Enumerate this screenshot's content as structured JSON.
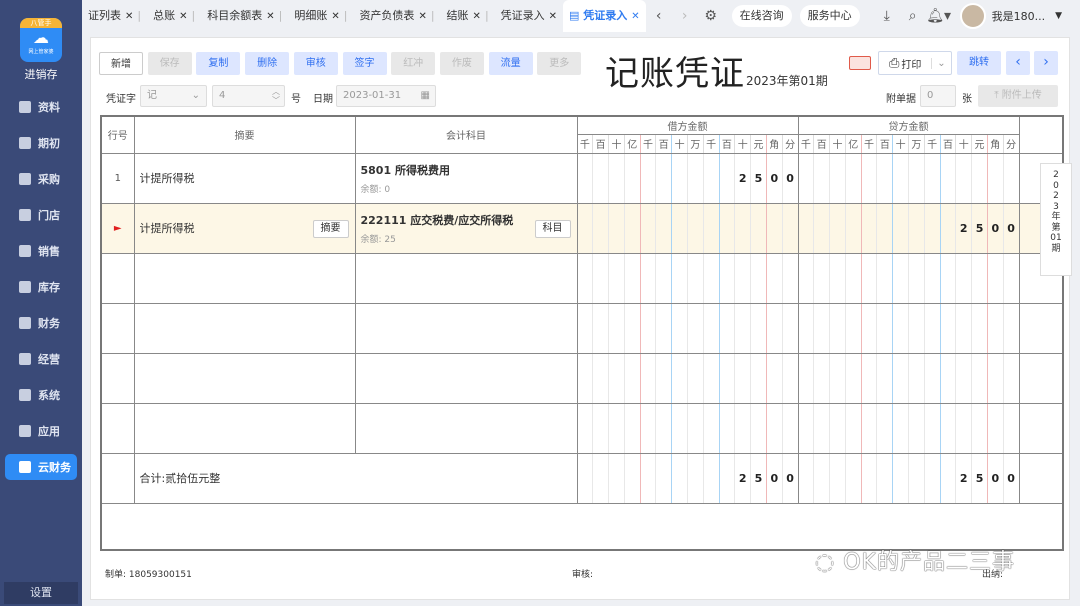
{
  "sidebar": {
    "app_name": "进销存",
    "logo_band": "八管手",
    "logo_sub": "网上管家婆",
    "items": [
      {
        "label": "资料"
      },
      {
        "label": "期初"
      },
      {
        "label": "采购"
      },
      {
        "label": "门店"
      },
      {
        "label": "销售"
      },
      {
        "label": "库存"
      },
      {
        "label": "财务"
      },
      {
        "label": "经营"
      },
      {
        "label": "系统"
      },
      {
        "label": "应用"
      },
      {
        "label": "云财务",
        "active": true
      }
    ],
    "settings": "设置"
  },
  "tabs": [
    {
      "label": "证列表"
    },
    {
      "label": "总账"
    },
    {
      "label": "科目余额表"
    },
    {
      "label": "明细账"
    },
    {
      "label": "资产负债表"
    },
    {
      "label": "结账"
    },
    {
      "label": "凭证录入"
    },
    {
      "label": "凭证录入",
      "active": true
    }
  ],
  "topbar": {
    "online": "在线咨询",
    "service": "服务中心",
    "user": "我是180..."
  },
  "toolbar": {
    "buttons": [
      {
        "label": "新增",
        "style": "w"
      },
      {
        "label": "保存",
        "style": "g"
      },
      {
        "label": "复制",
        "style": "b"
      },
      {
        "label": "删除",
        "style": "b"
      },
      {
        "label": "审核",
        "style": "b"
      },
      {
        "label": "签字",
        "style": "b"
      },
      {
        "label": "红冲",
        "style": "g"
      },
      {
        "label": "作废",
        "style": "g"
      },
      {
        "label": "流量",
        "style": "b"
      },
      {
        "label": "更多",
        "style": "g"
      }
    ],
    "print": "打印",
    "jump": "跳转"
  },
  "voucher": {
    "title": "记账凭证",
    "period": "2023年第01期",
    "word_label": "凭证字",
    "word": "记",
    "number": "4",
    "number_suffix": "号",
    "date_label": "日期",
    "date": "2023-01-31",
    "attach_label": "附单据",
    "attach_count": "0",
    "attach_unit": "张",
    "upload": "附件上传"
  },
  "table": {
    "headers": {
      "row": "行号",
      "summary": "摘要",
      "account": "会计科目",
      "debit": "借方金额",
      "credit": "贷方金额"
    },
    "digits": [
      "千",
      "百",
      "十",
      "亿",
      "千",
      "百",
      "十",
      "万",
      "千",
      "百",
      "十",
      "元",
      "角",
      "分"
    ],
    "rows": [
      {
        "no": "1",
        "summary": "计提所得税",
        "account": "5801  所得税费用",
        "balance": "余额: 0",
        "debit": "2500",
        "credit": ""
      },
      {
        "no": "►",
        "summary": "计提所得税",
        "account": "222111  应交税费/应交所得税",
        "balance": "余额: 25",
        "debit": "",
        "credit": "2500",
        "active": true,
        "summary_btn": "摘要",
        "account_btn": "科目"
      },
      {
        "no": "",
        "summary": "",
        "account": "",
        "balance": "",
        "debit": "",
        "credit": ""
      },
      {
        "no": "",
        "summary": "",
        "account": "",
        "balance": "",
        "debit": "",
        "credit": ""
      },
      {
        "no": "",
        "summary": "",
        "account": "",
        "balance": "",
        "debit": "",
        "credit": ""
      },
      {
        "no": "",
        "summary": "",
        "account": "",
        "balance": "",
        "debit": "",
        "credit": ""
      }
    ],
    "total": {
      "label": "合计:贰拾伍元整",
      "debit": "2500",
      "credit": "2500"
    }
  },
  "side_period": [
    "2",
    "0",
    "2",
    "3",
    "年",
    "第",
    "01",
    "期"
  ],
  "footer": {
    "maker": "制单: 18059300151",
    "auditor": "审核:",
    "cashier": "出纳:"
  },
  "watermark": "OK的产品二三事"
}
